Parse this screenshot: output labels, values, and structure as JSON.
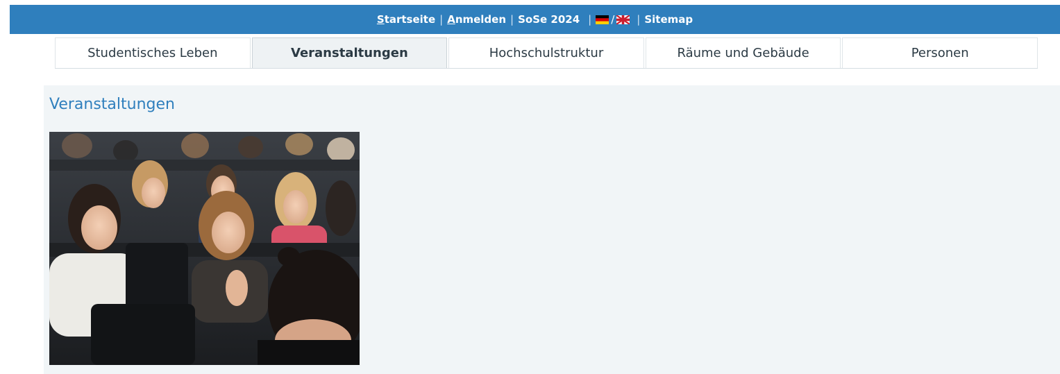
{
  "topbar": {
    "startseite": "Startseite",
    "startseite_accel": "S",
    "startseite_rest": "tartseite",
    "anmelden_accel": "A",
    "anmelden_rest": "nmelden",
    "semester": "SoSe 2024",
    "lang_separator": "/",
    "sitemap": "Sitemap",
    "separator": "|"
  },
  "nav": {
    "tabs": [
      {
        "label": "Studentisches Leben"
      },
      {
        "label": "Veranstaltungen"
      },
      {
        "label": "Hochschulstruktur"
      },
      {
        "label": "Räume und Gebäude"
      },
      {
        "label": "Personen"
      }
    ],
    "active_index": 1
  },
  "main": {
    "title": "Veranstaltungen"
  },
  "colors": {
    "brand_blue": "#2f7fbd",
    "content_bg": "#f1f5f7"
  },
  "icons": {
    "german_flag": "german-flag-icon",
    "uk_flag": "uk-flag-icon"
  }
}
